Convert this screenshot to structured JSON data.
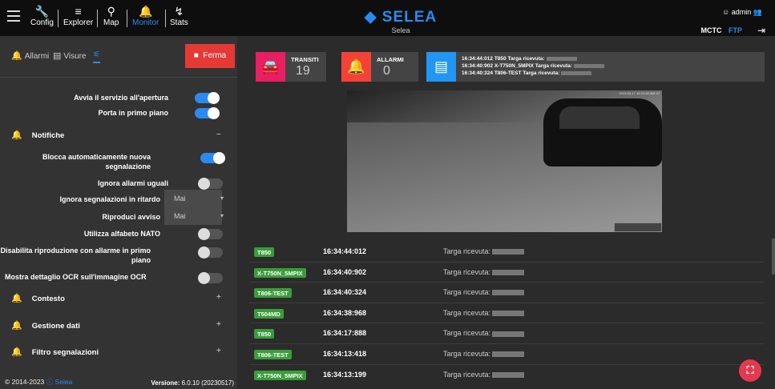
{
  "nav": {
    "items": [
      {
        "label": "Config",
        "icon": "wrench-icon"
      },
      {
        "label": "Explorer",
        "icon": "explorer-icon"
      },
      {
        "label": "Map",
        "icon": "map-pin-icon"
      },
      {
        "label": "Monitor",
        "icon": "bell-icon"
      },
      {
        "label": "Stats",
        "icon": "stats-icon"
      }
    ],
    "active": "Monitor"
  },
  "brand": {
    "logo": "SELEA",
    "subtitle": "Selea"
  },
  "user": {
    "name": "admin"
  },
  "top_right": {
    "mctc": "MCTC",
    "ftp": "FTP"
  },
  "sidebar": {
    "tabs": [
      {
        "label": "Allarmi"
      },
      {
        "label": "Visure"
      },
      {
        "label": ""
      }
    ],
    "stop_button": "Ferma",
    "settings": [
      {
        "label": "Avvia il servizio all'apertura",
        "state": "on"
      },
      {
        "label": "Porta in primo piano",
        "state": "on"
      }
    ],
    "notifiche": {
      "title": "Notifiche",
      "sign": "–",
      "items": [
        {
          "label": "Blocca automaticamente nuova segnalazione",
          "state": "on"
        },
        {
          "label": "Ignora allarmi uguali",
          "state": "off"
        },
        {
          "label": "Ignora segnalazioni in ritardo",
          "select": "Mai"
        },
        {
          "label": "Riproduci avviso",
          "select": "Mai"
        },
        {
          "label": "Utilizza alfabeto NATO",
          "state": "off"
        },
        {
          "label": "Disabilita riproduzione con allarme in primo piano",
          "state": "off"
        },
        {
          "label": "Mostra dettaglio OCR sull'immagine OCR",
          "state": "off"
        }
      ]
    },
    "sections": [
      {
        "title": "Contesto",
        "sign": "+"
      },
      {
        "title": "Gestione dati",
        "sign": "+"
      },
      {
        "title": "Filtro segnalazioni",
        "sign": "+"
      }
    ],
    "footer": {
      "copyright": "© 2014-2023",
      "company": "Selea",
      "version_label": "Versione:",
      "version": "6.0.10 (20230517)"
    }
  },
  "cards": {
    "transits": {
      "label": "TRANSITI",
      "value": "19",
      "color": "#e91e63"
    },
    "alarms": {
      "label": "ALLARMI",
      "value": "0",
      "color": "#f44336"
    }
  },
  "log_lines": [
    "16:34:44:012 T850 Targa ricevuta:",
    "16:34:40:902 X-T750N_5MPIX Targa ricevuta:",
    "16:34:40:324 T806-TEST Targa ricevuta:"
  ],
  "camera": {
    "timestamp": "2023-05-17 16:34:38.968 GT"
  },
  "transits": [
    {
      "plate": "T850",
      "time": "16:34:44:012",
      "message": "Targa ricevuta:"
    },
    {
      "plate": "X-T750N_5MPIX",
      "time": "16:34:40:902",
      "message": "Targa ricevuta:"
    },
    {
      "plate": "T806-TEST",
      "time": "16:34:40:324",
      "message": "Targa ricevuta:"
    },
    {
      "plate": "T504MD",
      "time": "16:34:38:968",
      "message": "Targa ricevuta:"
    },
    {
      "plate": "T850",
      "time": "16:34:17:888",
      "message": "Targa ricevuta:"
    },
    {
      "plate": "T806-TEST",
      "time": "16:34:13:418",
      "message": "Targa ricevuta:"
    },
    {
      "plate": "X-T750N_5MPIX",
      "time": "16:34:13:199",
      "message": "Targa ricevuta:"
    }
  ]
}
